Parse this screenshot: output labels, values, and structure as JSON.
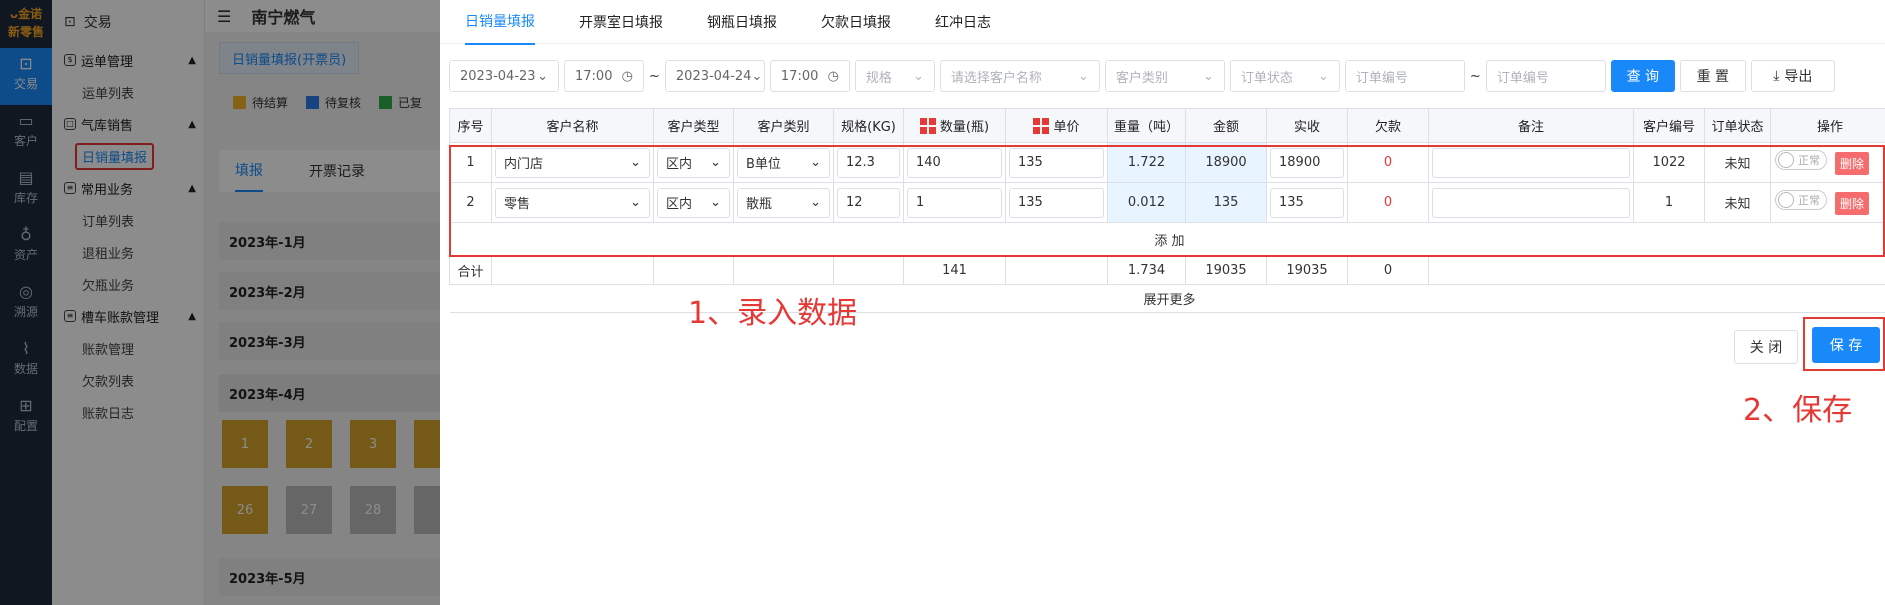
{
  "rail": {
    "logo_top": "ᴗ金诺",
    "logo_bottom": "新零售",
    "items": [
      "交易",
      "客户",
      "库存",
      "资产",
      "溯源",
      "数据",
      "配置"
    ]
  },
  "side": {
    "title": "交易",
    "groups": [
      {
        "label": "运单管理",
        "items": [
          "运单列表"
        ]
      },
      {
        "label": "气库销售",
        "items": [
          "日销量填报"
        ]
      },
      {
        "label": "常用业务",
        "items": [
          "订单列表",
          "退租业务",
          "欠瓶业务"
        ]
      },
      {
        "label": "槽车账款管理",
        "items": [
          "账款管理",
          "欠款列表",
          "账款日志"
        ]
      }
    ]
  },
  "main": {
    "title": "南宁燃气",
    "tab": "日销量填报(开票员)",
    "legend": [
      "待结算",
      "待复核",
      "已复"
    ],
    "ptabs": [
      "填报",
      "开票记录"
    ],
    "months": [
      "2023年-1月",
      "2023年-2月",
      "2023年-3月",
      "2023年-4月",
      "2023年-5月"
    ],
    "days": [
      "1",
      "2",
      "3",
      "",
      "26",
      "27",
      "28",
      ""
    ]
  },
  "modal": {
    "tabs": [
      "日销量填报",
      "开票室日填报",
      "钢瓶日填报",
      "欠款日填报",
      "红冲日志"
    ],
    "filters": {
      "date_start": "2023-04-23",
      "time_start": "17:00",
      "sep": "~",
      "date_end": "2023-04-24",
      "time_end": "17:00",
      "spec": "规格",
      "customer": "请选择客户名称",
      "cust_cat": "客户类别",
      "order_status": "订单状态",
      "order_no_from": "订单编号",
      "order_no_to": "订单编号",
      "query": "查 询",
      "reset": "重 置",
      "export": "导出"
    },
    "headers": [
      "序号",
      "客户名称",
      "客户类型",
      "客户类别",
      "规格(KG)",
      "数量(瓶)",
      "单价",
      "重量（吨）",
      "金额",
      "实收",
      "欠款",
      "备注",
      "客户编号",
      "订单状态",
      "操作"
    ],
    "rows": [
      {
        "no": "1",
        "name": "内门店",
        "type": "区内",
        "cat": "B单位",
        "spec": "12.3",
        "qty": "140",
        "price": "135",
        "weight": "1.722",
        "amount": "18900",
        "paid": "18900",
        "owe": "0",
        "remark": "",
        "code": "1022",
        "status": "未知",
        "toggle": "正常",
        "del": "删除"
      },
      {
        "no": "2",
        "name": "零售",
        "type": "区内",
        "cat": "散瓶",
        "spec": "12",
        "qty": "1",
        "price": "135",
        "weight": "0.012",
        "amount": "135",
        "paid": "135",
        "owe": "0",
        "remark": "",
        "code": "1",
        "status": "未知",
        "toggle": "正常",
        "del": "删除"
      }
    ],
    "add": "添 加",
    "total": {
      "label": "合计",
      "qty": "141",
      "weight": "1.734",
      "amount": "19035",
      "paid": "19035",
      "owe": "0"
    },
    "more": "展开更多",
    "close": "关 闭",
    "save": "保 存"
  },
  "annotations": {
    "step1": "1、录入数据",
    "step2": "2、保存"
  },
  "colors": {
    "accent": "#1989fa",
    "annotation": "#e53935",
    "pending": "#f0b429",
    "review": "#2b7de9",
    "done": "#2fae49"
  }
}
